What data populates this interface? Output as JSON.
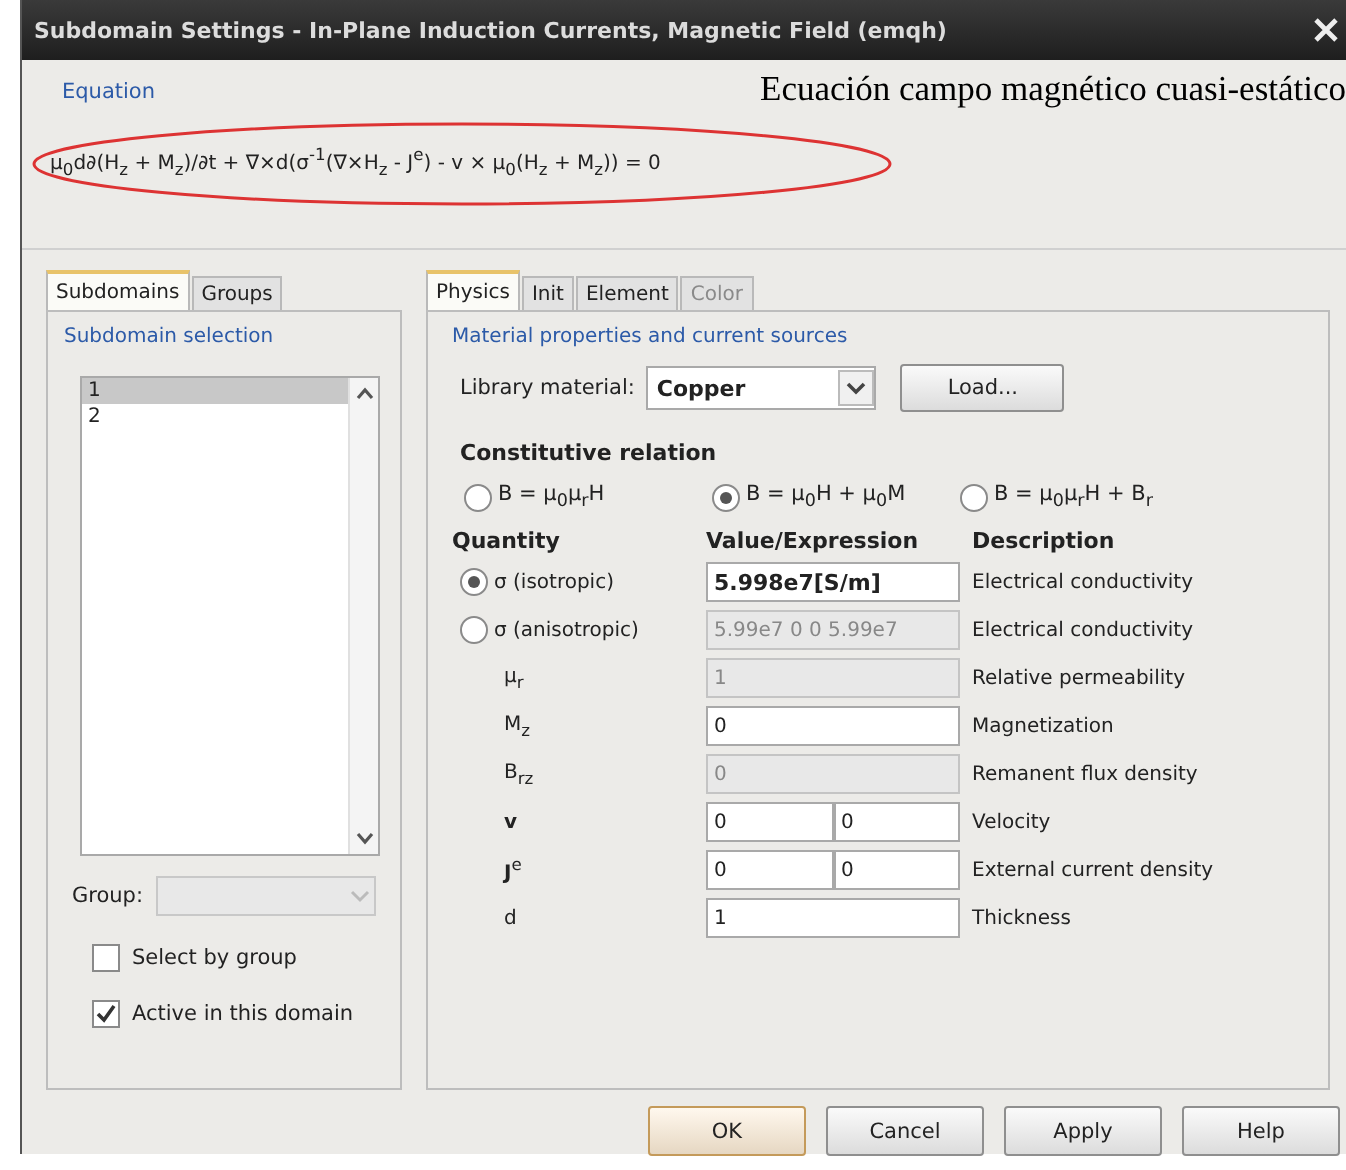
{
  "window": {
    "title": "Subdomain Settings - In-Plane Induction Currents, Magnetic Field (emqh)"
  },
  "equation": {
    "label": "Equation",
    "formula": "μ$_{0}$d∂(H$_{z}$ + M$_{z}$)/∂t + ∇×d(σ$^{-1}$(∇×H$_{z}$ - J$^{e}$) - v × μ$_{0}$(H$_{z}$ + M$_{z}$)) = 0",
    "annotation": "Ecuación campo magnético cuasi-estático"
  },
  "left": {
    "tabs": [
      {
        "label": "Subdomains",
        "selected": true
      },
      {
        "label": "Groups",
        "selected": false
      }
    ],
    "section": "Subdomain selection",
    "items": [
      {
        "label": "1",
        "selected": true
      },
      {
        "label": "2",
        "selected": false
      }
    ],
    "group_label": "Group:",
    "checkboxes": [
      {
        "label": "Select by group",
        "checked": false
      },
      {
        "label": "Active in this domain",
        "checked": true
      }
    ]
  },
  "right": {
    "tabs": [
      {
        "label": "Physics",
        "selected": true,
        "disabled": false
      },
      {
        "label": "Init",
        "selected": false,
        "disabled": false
      },
      {
        "label": "Element",
        "selected": false,
        "disabled": false
      },
      {
        "label": "Color",
        "selected": false,
        "disabled": true
      }
    ],
    "section": "Material properties and current sources",
    "library": {
      "label": "Library material:",
      "value": "Copper",
      "button": "Load..."
    },
    "constitutive": {
      "title": "Constitutive relation",
      "options": [
        {
          "label": "B = μ$_{0}$μ$_{r}$H",
          "selected": false
        },
        {
          "label": "B = μ$_{0}$H + μ$_{0}$M",
          "selected": true
        },
        {
          "label": "B = μ$_{0}$μ$_{r}$H + B$_{r}$",
          "selected": false
        }
      ]
    },
    "headers": [
      "Quantity",
      "Value/Expression",
      "Description"
    ],
    "rows": [
      {
        "kind": "radio",
        "quantity": "σ (isotropic)",
        "selected": true,
        "values": [
          {
            "text": "5.998e7[S/m]",
            "disabled": false
          }
        ],
        "description": "Electrical conductivity"
      },
      {
        "kind": "radio",
        "quantity": "σ (anisotropic)",
        "selected": false,
        "values": [
          {
            "text": "5.99e7 0 0 5.99e7",
            "disabled": true
          }
        ],
        "description": "Electrical conductivity"
      },
      {
        "kind": "label",
        "quantity": "μ$_{r}$",
        "values": [
          {
            "text": "1",
            "disabled": true
          }
        ],
        "description": "Relative permeability"
      },
      {
        "kind": "label",
        "quantity": "M$_{z}$",
        "values": [
          {
            "text": "0",
            "disabled": false
          }
        ],
        "description": "Magnetization"
      },
      {
        "kind": "label",
        "quantity": "B$_{rz}$",
        "values": [
          {
            "text": "0",
            "disabled": true
          }
        ],
        "description": "Remanent flux density"
      },
      {
        "kind": "label",
        "quantity": "**v**",
        "values": [
          {
            "text": "0",
            "disabled": false
          },
          {
            "text": "0",
            "disabled": false
          }
        ],
        "description": "Velocity"
      },
      {
        "kind": "label",
        "quantity": "**J**$^{e}$",
        "values": [
          {
            "text": "0",
            "disabled": false
          },
          {
            "text": "0",
            "disabled": false
          }
        ],
        "description": "External current density"
      },
      {
        "kind": "label",
        "quantity": "d",
        "values": [
          {
            "text": "1",
            "disabled": false
          }
        ],
        "description": "Thickness"
      }
    ]
  },
  "buttons": [
    {
      "label": "OK",
      "default": true
    },
    {
      "label": "Cancel",
      "default": false
    },
    {
      "label": "Apply",
      "default": false
    },
    {
      "label": "Help",
      "default": false
    }
  ]
}
